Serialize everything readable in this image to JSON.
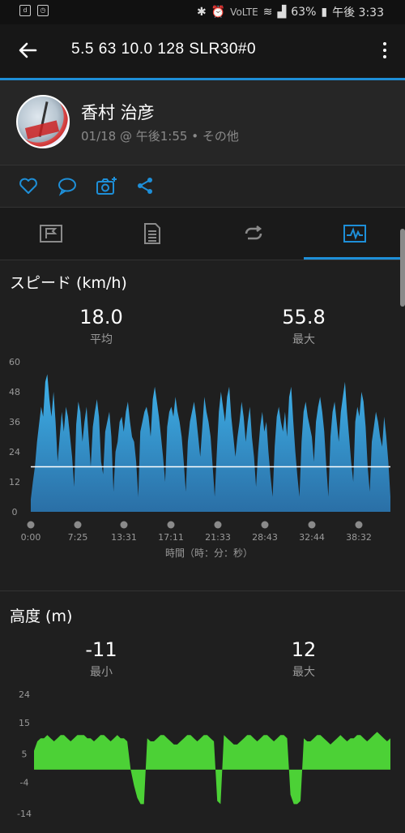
{
  "status_bar": {
    "battery": "63%",
    "time": "午後 3:33",
    "network_label": "VoLTE"
  },
  "app_bar": {
    "title": "5.5  63  10.0  128  SLR30#0"
  },
  "profile": {
    "name": "香村 治彦",
    "meta": "01/18 @ 午後1:55 • その他"
  },
  "actions": [
    "heart-icon",
    "comment-icon",
    "camera-add-icon",
    "share-icon"
  ],
  "tabs": [
    "summary-tab",
    "details-tab",
    "laps-tab",
    "charts-tab"
  ],
  "speed_section": {
    "title": "スピード (km/h)",
    "avg_value": "18.0",
    "avg_label": "平均",
    "max_value": "55.8",
    "max_label": "最大",
    "x_axis_label": "時間（時：分：秒）"
  },
  "elevation_section": {
    "title": "高度 (m)",
    "min_value": "-11",
    "min_label": "最小",
    "max_value": "12",
    "max_label": "最大"
  },
  "colors": {
    "accent": "#1e8fd8",
    "speed_fill": "#3ba6dc",
    "elevation_fill": "#4cd136"
  },
  "chart_data": [
    {
      "type": "area",
      "ylim": [
        0,
        60
      ],
      "yticks": [
        0,
        12,
        24,
        36,
        48,
        60
      ],
      "x_tick_labels": [
        "0:00",
        "7:25",
        "13:31",
        "17:11",
        "21:33",
        "28:43",
        "32:44",
        "38:32"
      ],
      "average_line": 18.0,
      "series": [
        {
          "values": [
            5,
            12,
            18,
            28,
            35,
            42,
            38,
            52,
            55,
            45,
            38,
            48,
            36,
            20,
            30,
            40,
            32,
            42,
            38,
            30,
            22,
            10,
            35,
            44,
            40,
            28,
            36,
            42,
            30,
            18,
            34,
            40,
            45,
            38,
            20,
            15,
            32,
            36,
            40,
            30,
            8,
            24,
            28,
            36,
            38,
            32,
            40,
            44,
            36,
            30,
            28,
            20,
            6,
            32,
            36,
            40,
            42,
            38,
            30,
            45,
            50,
            44,
            38,
            30,
            22,
            12,
            34,
            40,
            42,
            38,
            46,
            40,
            36,
            30,
            20,
            8,
            28,
            36,
            40,
            44,
            38,
            30,
            22,
            34,
            46,
            40,
            36,
            30,
            18,
            6,
            24,
            40,
            48,
            42,
            36,
            46,
            50,
            38,
            30,
            22,
            30,
            36,
            44,
            38,
            28,
            36,
            42,
            30,
            22,
            10,
            24,
            34,
            40,
            32,
            36,
            24,
            14,
            6,
            26,
            38,
            42,
            36,
            32,
            40,
            30,
            46,
            50,
            36,
            24,
            14,
            6,
            28,
            40,
            44,
            38,
            34,
            30,
            20,
            36,
            42,
            46,
            40,
            32,
            18,
            6,
            30,
            40,
            44,
            36,
            28,
            40,
            46,
            52,
            40,
            30,
            20,
            12,
            36,
            42,
            38,
            48,
            44,
            34,
            18,
            8,
            28,
            34,
            40,
            36,
            30,
            26,
            38,
            30,
            20,
            6
          ]
        }
      ]
    },
    {
      "type": "area",
      "ylim": [
        -14,
        24
      ],
      "yticks": [
        -14,
        -4,
        5,
        15,
        24
      ],
      "series": [
        {
          "values": [
            6,
            9,
            10,
            10,
            11,
            10,
            9,
            10,
            11,
            11,
            10,
            9,
            10,
            11,
            11,
            11,
            10,
            10,
            9,
            10,
            11,
            11,
            10,
            9,
            10,
            11,
            10,
            10,
            9,
            0,
            -5,
            -9,
            -11,
            -11,
            10,
            9,
            9,
            10,
            11,
            11,
            10,
            9,
            8,
            8,
            9,
            10,
            11,
            11,
            10,
            9,
            10,
            11,
            11,
            10,
            9,
            -10,
            -11,
            11,
            10,
            9,
            8,
            8,
            9,
            10,
            11,
            11,
            10,
            9,
            10,
            11,
            11,
            10,
            9,
            10,
            11,
            11,
            10,
            -8,
            -11,
            -11,
            -10,
            10,
            9,
            9,
            10,
            11,
            11,
            10,
            9,
            8,
            9,
            10,
            11,
            10,
            9,
            10,
            10,
            11,
            11,
            10,
            9,
            10,
            11,
            12,
            11,
            10,
            9,
            10
          ]
        }
      ]
    }
  ]
}
